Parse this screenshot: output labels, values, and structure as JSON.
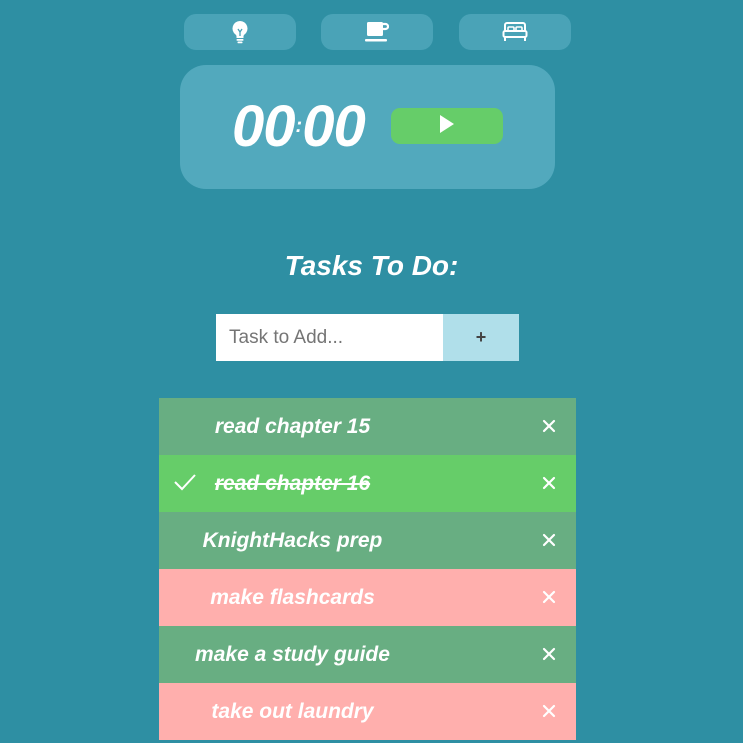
{
  "modes": [
    {
      "name": "focus",
      "icon": "lightbulb-icon"
    },
    {
      "name": "break",
      "icon": "coffee-cup-icon"
    },
    {
      "name": "sleep",
      "icon": "bed-icon"
    }
  ],
  "timer": {
    "minutes": "00",
    "separator": ":",
    "seconds": "00",
    "play_icon": "play-icon"
  },
  "tasks_section": {
    "title": "Tasks To Do:",
    "input_placeholder": "Task to Add...",
    "input_value": "",
    "add_label": "+"
  },
  "tasks": [
    {
      "text": "read chapter 15",
      "status": "normal",
      "checked": false
    },
    {
      "text": "read chapter 16",
      "status": "done",
      "checked": true
    },
    {
      "text": "KnightHacks prep",
      "status": "normal",
      "checked": false
    },
    {
      "text": "make flashcards",
      "status": "urgent",
      "checked": false
    },
    {
      "text": "make a study guide",
      "status": "normal",
      "checked": false
    },
    {
      "text": "take out laundry",
      "status": "urgent",
      "checked": false
    }
  ],
  "colors": {
    "background": "#2e8fa3",
    "button": "#4aa3b7",
    "timer_panel": "#52a9bd",
    "play_green": "#66cd69",
    "task_normal": "#68ae82",
    "task_done": "#66cd69",
    "task_urgent": "#ffafad",
    "add_button": "#b0dfea"
  }
}
